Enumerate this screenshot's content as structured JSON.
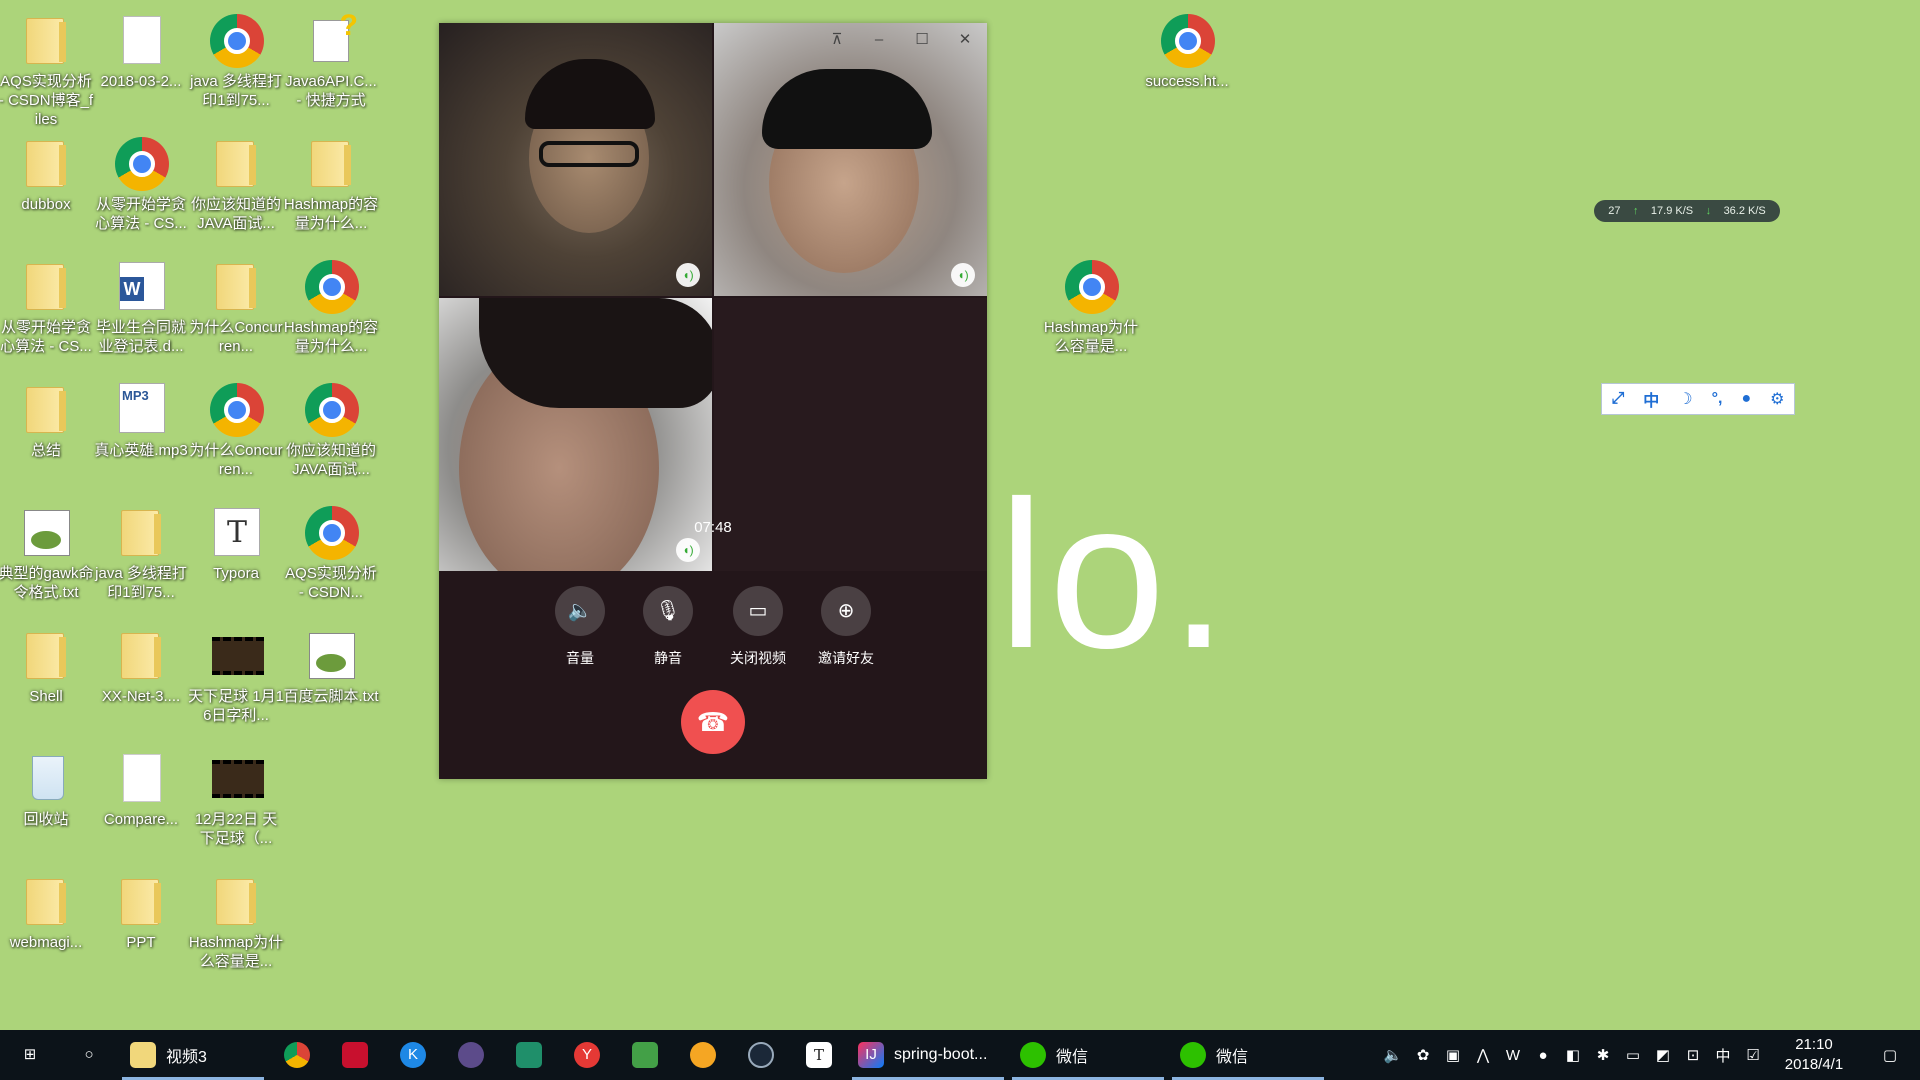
{
  "desktop": {
    "icons": [
      {
        "label": "AQS实现分析 - CSDN博客_files",
        "icon": "folder-icon"
      },
      {
        "label": "2018-03-2...",
        "icon": "document-icon"
      },
      {
        "label": "java 多线程打印1到75...",
        "icon": "chrome-icon"
      },
      {
        "label": "Java6API.C... - 快捷方式",
        "icon": "help-file-icon"
      },
      {
        "label": "dubbox",
        "icon": "folder-icon"
      },
      {
        "label": "从零开始学贪心算法 - CS...",
        "icon": "chrome-icon"
      },
      {
        "label": "你应该知道的JAVA面试...",
        "icon": "folder-icon"
      },
      {
        "label": "Hashmap的容量为什么...",
        "icon": "folder-icon"
      },
      {
        "label": "从零开始学贪心算法 - CS...",
        "icon": "folder-icon"
      },
      {
        "label": "毕业生合同就业登记表.d...",
        "icon": "word-icon"
      },
      {
        "label": "为什么Concurren...",
        "icon": "folder-icon"
      },
      {
        "label": "Hashmap的容量为什么...",
        "icon": "chrome-icon"
      },
      {
        "label": "总结",
        "icon": "folder-icon"
      },
      {
        "label": "真心英雄.mp3",
        "icon": "mp3-icon"
      },
      {
        "label": "为什么Concurren...",
        "icon": "chrome-icon"
      },
      {
        "label": "你应该知道的JAVA面试...",
        "icon": "chrome-icon"
      },
      {
        "label": "典型的gawk命令格式.txt",
        "icon": "gawk-icon"
      },
      {
        "label": "java 多线程打印1到75...",
        "icon": "folder-icon"
      },
      {
        "label": "Typora",
        "icon": "typora-icon"
      },
      {
        "label": "AQS实现分析 - CSDN...",
        "icon": "chrome-icon"
      },
      {
        "label": "Shell",
        "icon": "folder-icon"
      },
      {
        "label": "XX-Net-3....",
        "icon": "folder-icon"
      },
      {
        "label": "天下足球 1月16日字利...",
        "icon": "video-icon"
      },
      {
        "label": "百度云脚本.txt",
        "icon": "gawk-icon"
      },
      {
        "label": "回收站",
        "icon": "recycle-bin-icon"
      },
      {
        "label": "Compare...",
        "icon": "blank-file-icon"
      },
      {
        "label": "12月22日 天下足球（...",
        "icon": "video-icon"
      },
      {
        "label": "webmagi...",
        "icon": "folder-icon"
      },
      {
        "label": "PPT",
        "icon": "folder-icon"
      },
      {
        "label": "Hashmap为什么容量是...",
        "icon": "folder-icon"
      },
      {
        "label": "success.ht...",
        "icon": "chrome-icon"
      },
      {
        "label": "Hashmap为什么容量是...",
        "icon": "chrome-icon"
      }
    ],
    "big_text": "lo."
  },
  "call": {
    "timer": "07:48",
    "controls": [
      {
        "label": "音量",
        "icon": "volume-icon"
      },
      {
        "label": "静音",
        "icon": "microphone-icon"
      },
      {
        "label": "关闭视频",
        "icon": "camera-icon"
      },
      {
        "label": "邀请好友",
        "icon": "add-user-icon"
      }
    ]
  },
  "netmon": {
    "cpu": "27",
    "up": "17.9 K/S",
    "down": "36.2 K/S"
  },
  "ime": {
    "mode": "中"
  },
  "taskbar": {
    "items": [
      {
        "label": "视频3"
      },
      {
        "label": "spring-boot..."
      },
      {
        "label": "微信"
      },
      {
        "label": "微信"
      }
    ],
    "tray_ime": "中",
    "time": "21:10",
    "date": "2018/4/1"
  },
  "colors": {
    "desktop": "#acd47a",
    "hangup": "#f05050",
    "taskbar": "#0c1319"
  }
}
